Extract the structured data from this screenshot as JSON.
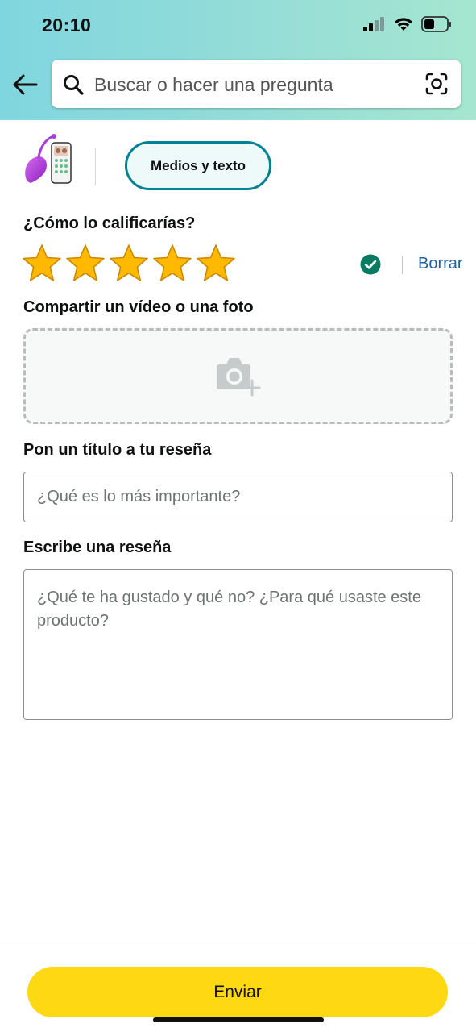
{
  "status_bar": {
    "time": "20:10",
    "icons": [
      "signal-icon",
      "wifi-icon",
      "battery-icon"
    ]
  },
  "header": {
    "back_icon": "back-arrow-icon",
    "search": {
      "placeholder": "Buscar o hacer una pregunta",
      "icon": "search-icon",
      "camera_icon": "camera-search-icon"
    },
    "colors": {
      "gradient_start": "#80d6df",
      "gradient_end": "#a6e6d0"
    }
  },
  "product": {
    "thumbnail_icon": "product-thumbnail",
    "mode_pill": "Medios y texto"
  },
  "rating": {
    "question": "¿Cómo lo calificarías?",
    "value": 5,
    "max": 5,
    "check_icon": "check-circle-icon",
    "clear_label": "Borrar"
  },
  "media": {
    "label": "Compartir un vídeo o una foto",
    "icon": "camera-add-icon"
  },
  "review_title": {
    "label": "Pon un título a tu reseña",
    "placeholder": "¿Qué es lo más importante?"
  },
  "review_body": {
    "label": "Escribe una reseña",
    "placeholder": "¿Qué te ha gustado y qué no? ¿Para qué usaste este producto?"
  },
  "submit": {
    "label": "Enviar",
    "color": "#ffd814"
  },
  "colors": {
    "accent_teal": "#008296",
    "link_blue": "#2162a1",
    "star_gold": "#ffb900",
    "check_green": "#067d62"
  }
}
